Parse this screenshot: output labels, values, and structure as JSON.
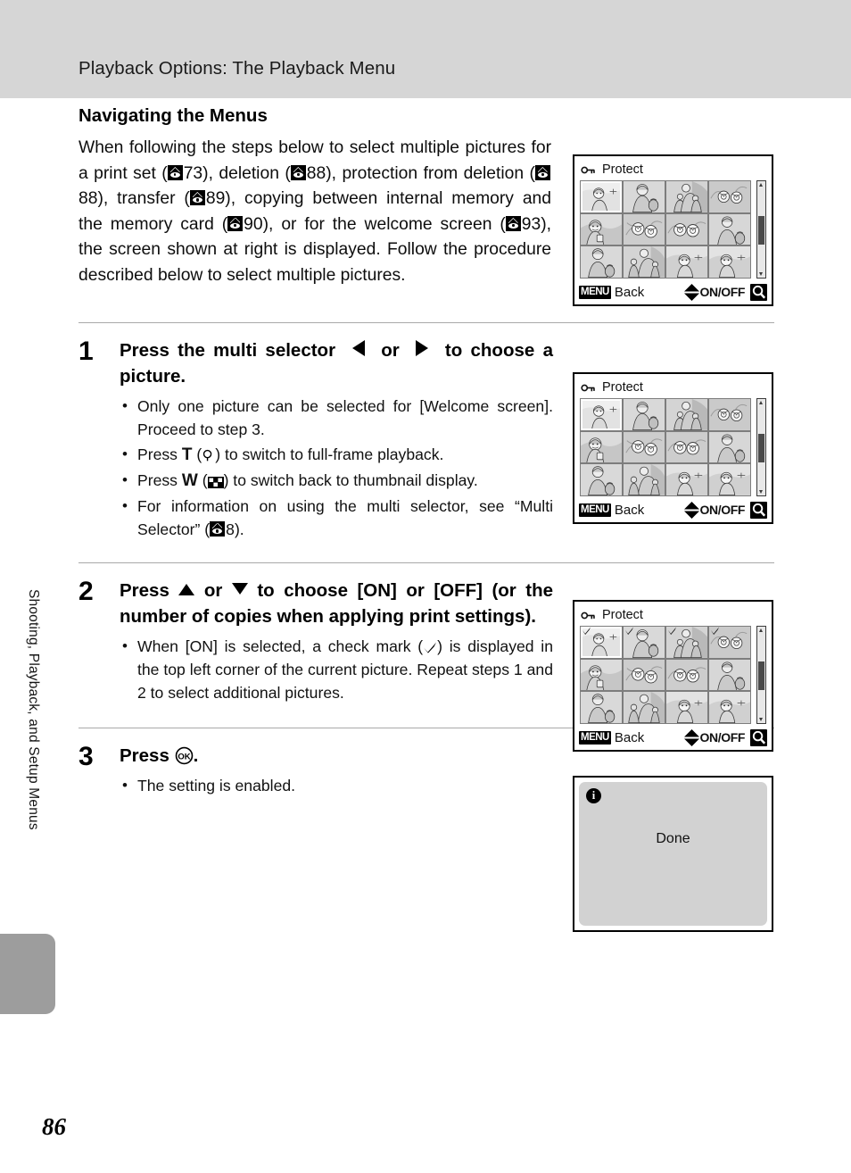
{
  "header": {
    "title": "Playback Options: The Playback Menu"
  },
  "sidebar": {
    "vertical_label": "Shooting, Playback, and Setup Menus",
    "tab_color": "#9d9d9d"
  },
  "page_number": "86",
  "section": {
    "heading": "Navigating the Menus",
    "intro_parts": {
      "p1": "When following the steps below to select multiple pictures for a print set (",
      "ref1": "73",
      "p2": "), deletion (",
      "ref2": "88",
      "p3": "), protection from deletion (",
      "ref3": "88",
      "p4": "), transfer (",
      "ref4": "89",
      "p5": "), copying between internal memory and the memory card (",
      "ref5": "90",
      "p6": "), or for the welcome screen (",
      "ref6": "93",
      "p7": "), the screen shown at right is displayed. Follow the procedure described below to select multiple pictures."
    }
  },
  "steps": [
    {
      "number": "1",
      "title_a": "Press the multi selector",
      "title_or": "or",
      "title_b": "to choose a picture.",
      "bullets": {
        "b1": "Only one picture can be selected for [Welcome screen]. Proceed to step 3.",
        "b2_pre": "Press",
        "b2_letter": "T",
        "b2_post": ") to switch to full-frame playback.",
        "b3_pre": "Press",
        "b3_letter": "W",
        "b3_post": ") to switch back to thumbnail display.",
        "b4_pre": "For information on using the multi selector, see “Multi Selector” (",
        "b4_ref": "8",
        "b4_post": ")."
      }
    },
    {
      "number": "2",
      "title_a": "Press",
      "title_or": "or",
      "title_b": "to choose [ON] or [OFF] (or the number of copies when applying print settings).",
      "bullets": {
        "b1_pre": "When [ON] is selected, a check mark (",
        "b1_post": ") is displayed in the top left corner of the current picture. Repeat steps 1 and 2 to select additional pictures."
      }
    },
    {
      "number": "3",
      "title_a": "Press",
      "title_b": ".",
      "bullets": {
        "b1": "The setting is enabled."
      }
    }
  ],
  "screens": [
    {
      "id": "protect-screen-1",
      "title": "Protect",
      "icon": "key-icon",
      "footer": {
        "menu": "MENU",
        "back": "Back",
        "onoff": "ON/OFF"
      },
      "checked_thumbs": []
    },
    {
      "id": "protect-screen-2",
      "title": "Protect",
      "icon": "key-icon",
      "footer": {
        "menu": "MENU",
        "back": "Back",
        "onoff": "ON/OFF"
      },
      "checked_thumbs": []
    },
    {
      "id": "protect-screen-3",
      "title": "Protect",
      "icon": "key-icon",
      "footer": {
        "menu": "MENU",
        "back": "Back",
        "onoff": "ON/OFF"
      },
      "checked_thumbs": [
        0,
        1,
        2,
        3
      ]
    }
  ],
  "done_dialog": {
    "info_glyph": "i",
    "message": "Done"
  },
  "colors": {
    "header_band": "#d6d6d6",
    "side_tab": "#9d9d9d",
    "screen_bg": "#ffffff",
    "thumb_bg": "#cfcfcf",
    "grid_gap": "#7d7d7d",
    "dialog_bg": "#d2d2d2",
    "rule": "#a9a9a9"
  }
}
